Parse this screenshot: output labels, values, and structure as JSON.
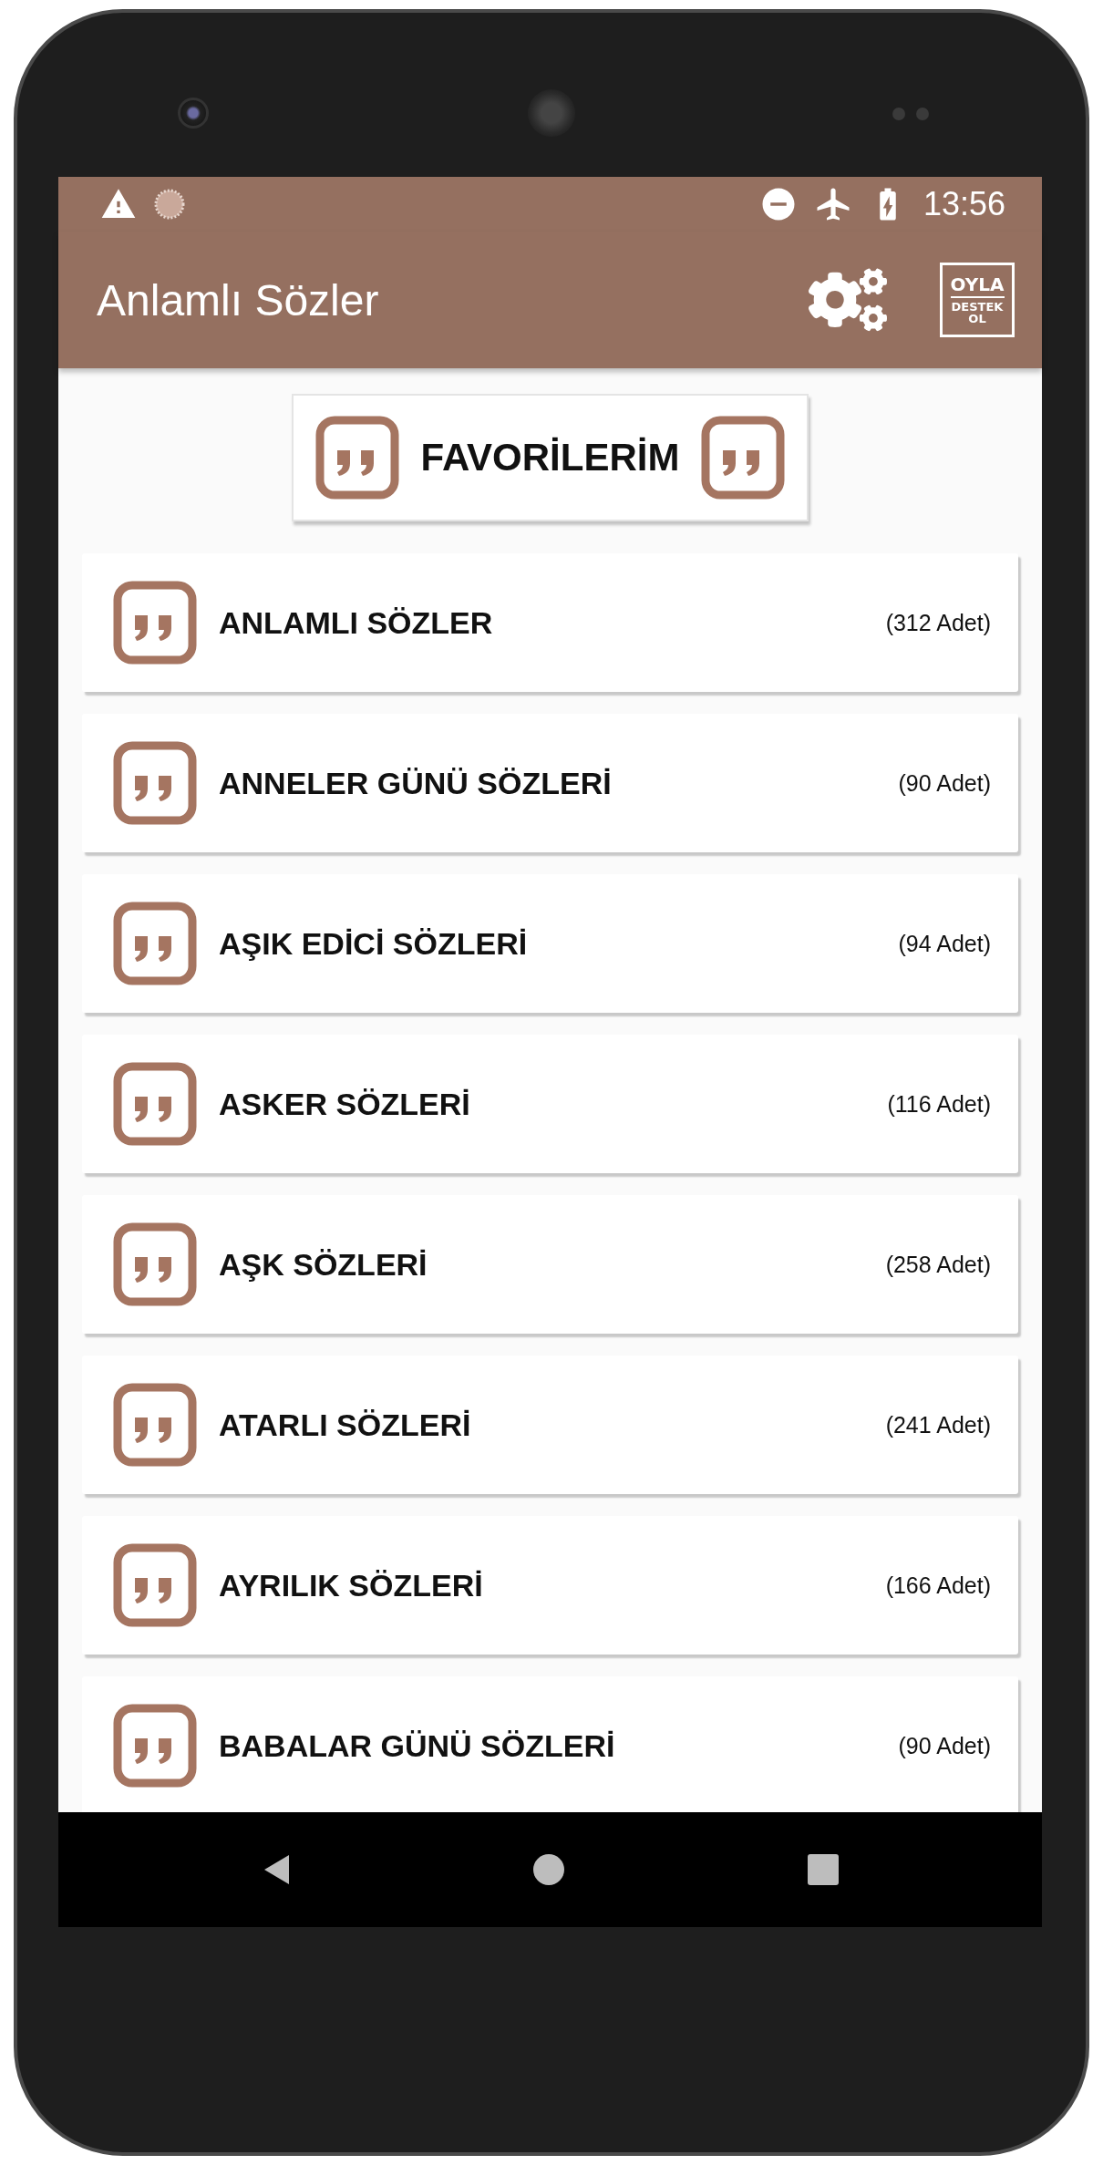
{
  "status_bar": {
    "time": "13:56"
  },
  "toolbar": {
    "title": "Anlamlı Sözler",
    "badge": {
      "line_1": "OYLA",
      "line_2": "DESTEK",
      "line_3": "OL"
    }
  },
  "favorites_button": {
    "label": "FAVORİLERİM"
  },
  "categories": [
    {
      "name": "ANLAMLI SÖZLER",
      "count": "(312 Adet)"
    },
    {
      "name": "ANNELER GÜNÜ SÖZLERİ",
      "count": "(90 Adet)"
    },
    {
      "name": "AŞIK EDİCİ SÖZLERİ",
      "count": "(94 Adet)"
    },
    {
      "name": "ASKER SÖZLERİ",
      "count": "(116 Adet)"
    },
    {
      "name": "AŞK SÖZLERİ",
      "count": "(258 Adet)"
    },
    {
      "name": "ATARLI SÖZLERİ",
      "count": "(241 Adet)"
    },
    {
      "name": "AYRILIK SÖZLERİ",
      "count": "(166 Adet)"
    },
    {
      "name": "BABALAR GÜNÜ SÖZLERİ",
      "count": "(90 Adet)"
    }
  ]
}
